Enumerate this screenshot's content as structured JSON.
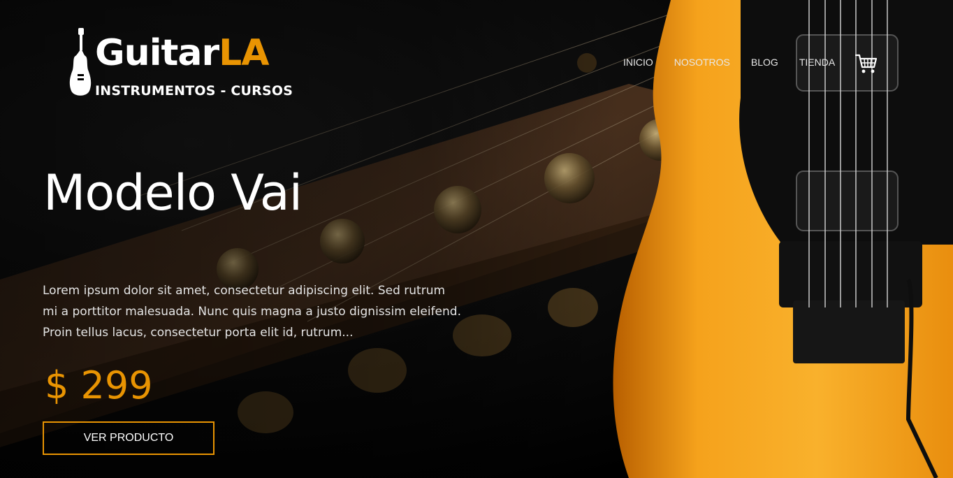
{
  "logo": {
    "name_main": "Guitar",
    "name_accent": "LA",
    "tagline": "INSTRUMENTOS - CURSOS",
    "icon": "guitar-icon",
    "accent_color": "#e99402"
  },
  "nav": {
    "items": [
      {
        "label": "INICIO"
      },
      {
        "label": "NOSOTROS"
      },
      {
        "label": "BLOG"
      },
      {
        "label": "TIENDA"
      }
    ],
    "cart_icon": "cart-icon"
  },
  "hero": {
    "title": "Modelo Vai",
    "description": "Lorem ipsum dolor sit amet, consectetur adipiscing elit. Sed rutrum mi a porttitor malesuada. Nunc quis magna a justo dignissim eleifend. Proin tellus lacus, consectetur porta elit id, rutrum...",
    "price": "$ 299",
    "cta_label": "VER PRODUCTO"
  },
  "colors": {
    "accent": "#e99402",
    "guitar_body": "#f39a1a",
    "background": "#000000",
    "text": "#ffffff"
  }
}
